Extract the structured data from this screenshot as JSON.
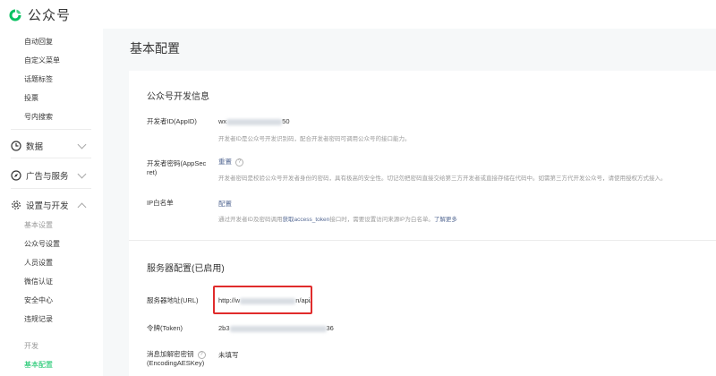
{
  "app": {
    "logo_text": "公众号",
    "brand_color": "#07c160"
  },
  "sidebar": {
    "top_items": [
      "自动回复",
      "自定义菜单",
      "话题标签",
      "投票",
      "号内搜索"
    ],
    "groups": [
      {
        "label": "数据",
        "icon": "clock-icon"
      },
      {
        "label": "广告与服务",
        "icon": "compass-icon"
      },
      {
        "label": "设置与开发",
        "icon": "gear-icon"
      }
    ],
    "settings_items": [
      "基本设置",
      "公众号设置",
      "人员设置",
      "微信认证",
      "安全中心",
      "违规记录"
    ],
    "dev_header": "开发",
    "dev_items": [
      "基本配置"
    ]
  },
  "main": {
    "title": "基本配置",
    "dev_info": {
      "title": "公众号开发信息",
      "appid_label": "开发者ID(AppID)",
      "appid_prefix": "wx",
      "appid_suffix": "50",
      "appid_desc": "开发者ID是公众号开发识别码，配合开发者密码可调用公众号的接口能力。",
      "secret_label_1": "开发者密码(AppSec",
      "secret_label_2": "ret)",
      "secret_action": "重置",
      "secret_help": "?",
      "secret_desc": "开发者密码是校验公众号开发者身份的密码，具有极高的安全性。切记勿把密码直接交给第三方开发者或直接存储在代码中。如需第三方代开发公众号，请使用授权方式接入。",
      "ip_label": "IP白名单",
      "ip_action": "配置",
      "ip_desc_pre": "通过开发者ID及密码调用",
      "ip_desc_link": "获取access_token",
      "ip_desc_post": "接口时，需要设置访问来源IP为白名单。",
      "ip_desc_more": "了解更多"
    },
    "server": {
      "title": "服务器配置(已启用)",
      "url_label": "服务器地址(URL)",
      "url_prefix": "http://w",
      "url_suffix": "n/api/",
      "token_label": "令牌(Token)",
      "token_prefix": "2b3",
      "token_suffix": "36",
      "aes_label_1": "消息加解密密钥",
      "aes_label_2": "(EncodingAESKey)",
      "aes_help": "?",
      "aes_value": "未填写"
    }
  }
}
